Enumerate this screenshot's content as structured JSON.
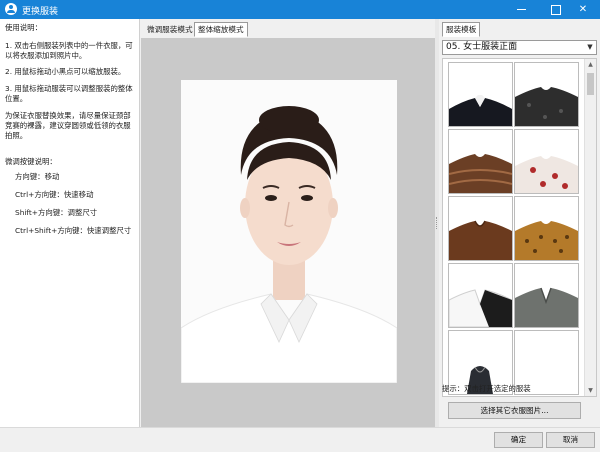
{
  "window": {
    "title": "更换服装",
    "minimize_icon": "minimize-icon",
    "maximize_icon": "maximize-icon",
    "close_glyph": "✕"
  },
  "instructions": {
    "heading": "使用说明：",
    "step1": "1. 双击右侧服装列表中的一件衣服，可以将衣服添加到照片中。",
    "step2": "2. 用鼠标拖动小黑点可以缩放服装。",
    "step3": "3. 用鼠标拖动服装可以调整服装的整体位置。",
    "tip": "为保证衣服替换效果，请尽量保证颈部竞赛的裸露，建议穿圆领或低领的衣服拍照。",
    "keys_heading": "微调按键说明：",
    "keys": [
      "方向键：移动",
      "Ctrl+方向键：快速移动",
      "Shift+方向键：调整尺寸",
      "Ctrl+Shift+方向键：快速调整尺寸"
    ]
  },
  "center": {
    "tabs": [
      "微调服装模式",
      "整体缩放模式"
    ],
    "active_tab": 1
  },
  "right_panel": {
    "tab_label": "服装模板",
    "category": "05. 女士服装正面",
    "hint": "提示：双击打开选定的服装",
    "choose_button": "选择其它衣服图片..."
  },
  "footer": {
    "ok": "确定",
    "cancel": "取消"
  },
  "colors": {
    "titlebar": "#1883d7",
    "accent_border": "#9a9a9a",
    "canvas_bg": "#c9c9c9"
  }
}
